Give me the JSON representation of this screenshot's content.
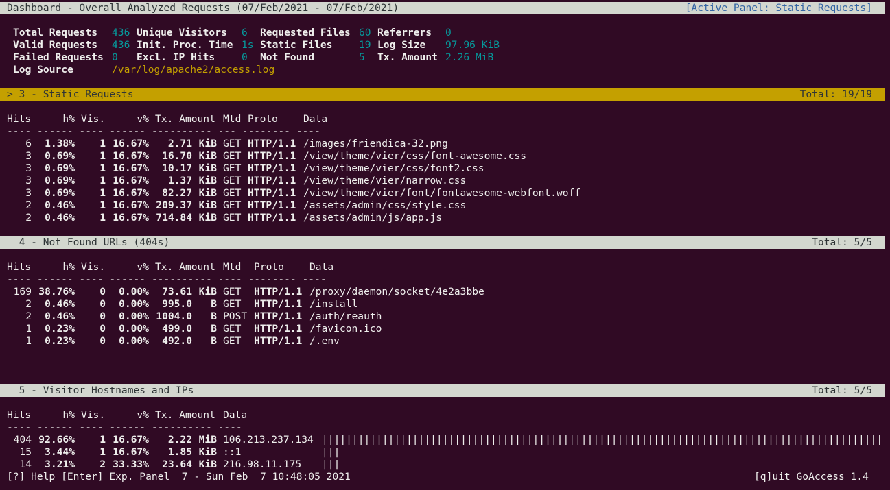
{
  "header": {
    "title": "Dashboard - Overall Analyzed Requests (07/Feb/2021 - 07/Feb/2021)",
    "active_panel": "[Active Panel: Static Requests]"
  },
  "overall": {
    "total_requests_label": "Total Requests",
    "total_requests_value": "436",
    "unique_visitors_label": "Unique Visitors",
    "unique_visitors_value": "6",
    "requested_files_label": "Requested Files",
    "requested_files_value": "60",
    "referrers_label": "Referrers",
    "referrers_value": "0",
    "valid_requests_label": "Valid Requests",
    "valid_requests_value": "436",
    "init_proc_time_label": "Init. Proc. Time",
    "init_proc_time_value": "1s",
    "static_files_label": "Static Files",
    "static_files_value": "19",
    "log_size_label": "Log Size",
    "log_size_value": "97.96 KiB",
    "failed_requests_label": "Failed Requests",
    "failed_requests_value": "0",
    "excl_ip_hits_label": "Excl. IP Hits",
    "excl_ip_hits_value": "0",
    "not_found_label": "Not Found",
    "not_found_value": "5",
    "tx_amount_label": "Tx. Amount",
    "tx_amount_value": "2.26 MiB",
    "log_source_label": "Log Source",
    "log_source_value": "/var/log/apache2/access.log"
  },
  "static_panel": {
    "title": "> 3 - Static Requests",
    "total": "Total: 19/19",
    "col_hits": "Hits",
    "col_hpct": "h%",
    "col_vis": "Vis.",
    "col_vpct": "v%",
    "col_tx": "Tx. Amount",
    "col_mtd": "Mtd",
    "col_proto": "Proto",
    "col_data": "Data",
    "separator": "---- ------ ---- ------ ---------- --- -------- ----",
    "rows": [
      {
        "hits": "6",
        "hpct": "1.38%",
        "vis": "1",
        "vpct": "16.67%",
        "tx": "2.71",
        "unit": "KiB",
        "mtd": "GET",
        "proto": "HTTP/1.1",
        "data": "/images/friendica-32.png"
      },
      {
        "hits": "3",
        "hpct": "0.69%",
        "vis": "1",
        "vpct": "16.67%",
        "tx": "16.70",
        "unit": "KiB",
        "mtd": "GET",
        "proto": "HTTP/1.1",
        "data": "/view/theme/vier/css/font-awesome.css"
      },
      {
        "hits": "3",
        "hpct": "0.69%",
        "vis": "1",
        "vpct": "16.67%",
        "tx": "10.17",
        "unit": "KiB",
        "mtd": "GET",
        "proto": "HTTP/1.1",
        "data": "/view/theme/vier/css/font2.css"
      },
      {
        "hits": "3",
        "hpct": "0.69%",
        "vis": "1",
        "vpct": "16.67%",
        "tx": "1.37",
        "unit": "KiB",
        "mtd": "GET",
        "proto": "HTTP/1.1",
        "data": "/view/theme/vier/narrow.css"
      },
      {
        "hits": "3",
        "hpct": "0.69%",
        "vis": "1",
        "vpct": "16.67%",
        "tx": "82.27",
        "unit": "KiB",
        "mtd": "GET",
        "proto": "HTTP/1.1",
        "data": "/view/theme/vier/font/fontawesome-webfont.woff"
      },
      {
        "hits": "2",
        "hpct": "0.46%",
        "vis": "1",
        "vpct": "16.67%",
        "tx": "209.37",
        "unit": "KiB",
        "mtd": "GET",
        "proto": "HTTP/1.1",
        "data": "/assets/admin/css/style.css"
      },
      {
        "hits": "2",
        "hpct": "0.46%",
        "vis": "1",
        "vpct": "16.67%",
        "tx": "714.84",
        "unit": "KiB",
        "mtd": "GET",
        "proto": "HTTP/1.1",
        "data": "/assets/admin/js/app.js"
      }
    ]
  },
  "notfound_panel": {
    "title": "  4 - Not Found URLs (404s)",
    "total": "Total: 5/5",
    "col_hits": "Hits",
    "col_hpct": "h%",
    "col_vis": "Vis.",
    "col_vpct": "v%",
    "col_tx": "Tx. Amount",
    "col_mtd": "Mtd",
    "col_proto": "Proto",
    "col_data": "Data",
    "separator": "---- ------ ---- ------ ---------- ---- -------- ----",
    "rows": [
      {
        "hits": "169",
        "hpct": "38.76%",
        "vis": "0",
        "vpct": "0.00%",
        "tx": "73.61",
        "unit": "KiB",
        "mtd": "GET",
        "proto": "HTTP/1.1",
        "data": "/proxy/daemon/socket/4e2a3bbe"
      },
      {
        "hits": "2",
        "hpct": "0.46%",
        "vis": "0",
        "vpct": "0.00%",
        "tx": "995.0",
        "unit": "B",
        "mtd": "GET",
        "proto": "HTTP/1.1",
        "data": "/install"
      },
      {
        "hits": "2",
        "hpct": "0.46%",
        "vis": "0",
        "vpct": "0.00%",
        "tx": "1004.0",
        "unit": "B",
        "mtd": "POST",
        "proto": "HTTP/1.1",
        "data": "/auth/reauth"
      },
      {
        "hits": "1",
        "hpct": "0.23%",
        "vis": "0",
        "vpct": "0.00%",
        "tx": "499.0",
        "unit": "B",
        "mtd": "GET",
        "proto": "HTTP/1.1",
        "data": "/favicon.ico"
      },
      {
        "hits": "1",
        "hpct": "0.23%",
        "vis": "0",
        "vpct": "0.00%",
        "tx": "492.0",
        "unit": "B",
        "mtd": "GET",
        "proto": "HTTP/1.1",
        "data": "/.env"
      }
    ]
  },
  "hosts_panel": {
    "title": "  5 - Visitor Hostnames and IPs",
    "total": "Total: 5/5",
    "col_hits": "Hits",
    "col_hpct": "h%",
    "col_vis": "Vis.",
    "col_vpct": "v%",
    "col_tx": "Tx. Amount",
    "col_data": "Data",
    "separator": "---- ------ ---- ------ ---------- ----",
    "rows": [
      {
        "hits": "404",
        "hpct": "92.66%",
        "vis": "1",
        "vpct": "16.67%",
        "tx": "2.22",
        "unit": "MiB",
        "data": "106.213.237.134",
        "bar": "|||||||||||||||||||||||||||||||||||||||||||||||||||||||||||||||||||||||||||||||||||||||||||||||||||||||||||||||||"
      },
      {
        "hits": "15",
        "hpct": "3.44%",
        "vis": "1",
        "vpct": "16.67%",
        "tx": "1.85",
        "unit": "KiB",
        "data": "::1",
        "bar": "|||"
      },
      {
        "hits": "14",
        "hpct": "3.21%",
        "vis": "2",
        "vpct": "33.33%",
        "tx": "23.64",
        "unit": "KiB",
        "data": "216.98.11.175",
        "bar": "|||"
      }
    ]
  },
  "footer": {
    "help": "[?] Help [Enter] Exp. Panel  7 - Sun Feb  7 10:48:05 2021",
    "quit": "[q]uit GoAccess 1.4"
  }
}
